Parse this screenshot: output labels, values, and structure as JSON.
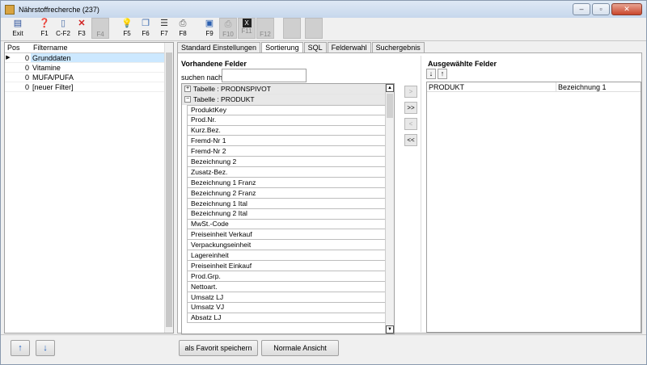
{
  "window": {
    "title": "Nährstoffrecherche (237)"
  },
  "toolbar": {
    "buttons": [
      {
        "label": "Exit",
        "icon": "exit-icon"
      },
      {
        "label": "F1",
        "icon": "help-icon"
      },
      {
        "label": "C-F2",
        "icon": "new-document-icon"
      },
      {
        "label": "F3",
        "icon": "delete-icon"
      },
      {
        "label": "F4",
        "icon": "blank-icon"
      },
      {
        "label": "F5",
        "icon": "lightbulb-icon"
      },
      {
        "label": "F6",
        "icon": "copy-icon"
      },
      {
        "label": "F7",
        "icon": "list-icon"
      },
      {
        "label": "F8",
        "icon": "print-icon"
      },
      {
        "label": "F9",
        "icon": "save-icon"
      },
      {
        "label": "F10",
        "icon": "print-disabled-icon"
      },
      {
        "label": "F11",
        "icon": "excel-icon"
      },
      {
        "label": "F12",
        "icon": "blank-icon"
      }
    ]
  },
  "filter_list": {
    "headers": {
      "pos": "Pos",
      "name": "Filtername"
    },
    "rows": [
      {
        "pos": "0",
        "name": "Grunddaten"
      },
      {
        "pos": "0",
        "name": "Vitamine"
      },
      {
        "pos": "0",
        "name": "MUFA/PUFA"
      },
      {
        "pos": "0",
        "name": "[neuer Filter]"
      }
    ]
  },
  "tabs": [
    "Standard Einstellungen",
    "Sortierung",
    "SQL",
    "Felderwahl",
    "Suchergebnis"
  ],
  "sort_panel": {
    "available_label": "Vorhandene Felder",
    "search_label": "suchen nach:",
    "search_value": "",
    "table1": "Tabelle : PRODNSPIVOT",
    "table2": "Tabelle : PRODUKT",
    "fields": [
      "ProduktKey",
      "Prod.Nr.",
      "Kurz.Bez.",
      "Fremd-Nr 1",
      "Fremd-Nr 2",
      "Bezeichnung 2",
      "Zusatz-Bez.",
      "Bezeichnung 1 Franz",
      "Bezeichnung 2 Franz",
      "Bezeichnung 1 Ital",
      "Bezeichnung 2 Ital",
      "MwSt.-Code",
      "Preiseinheit Verkauf",
      "Verpackungseinheit",
      "Lagereinheit",
      "Preiseinheit Einkauf",
      "Prod.Grp.",
      "Nettoart.",
      "Umsatz LJ",
      "Umsatz VJ",
      "Absatz LJ"
    ],
    "move_buttons": [
      ">",
      ">>",
      "<",
      "<<"
    ],
    "selected_label": "Ausgewählte Felder",
    "selected": [
      {
        "table": "PRODUKT",
        "field": "Bezeichnung 1"
      }
    ]
  },
  "bottom": {
    "save_favorite": "als Favorit speichern",
    "normal_view": "Normale Ansicht"
  }
}
